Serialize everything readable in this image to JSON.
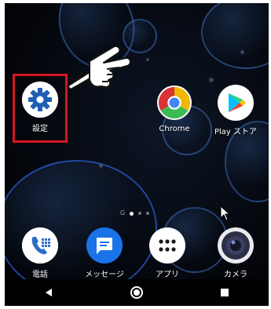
{
  "home_screen": {
    "top_row": [
      {
        "label": "設定",
        "icon": "settings-gear-icon",
        "color": "#1e5fb3"
      },
      {
        "label": "Chrome",
        "icon": "chrome-icon"
      },
      {
        "label": "Play ストア",
        "icon": "play-store-icon"
      }
    ],
    "dock": [
      {
        "label": "電話",
        "icon": "phone-icon",
        "color": "#2e6cc9"
      },
      {
        "label": "メッセージ",
        "icon": "message-icon",
        "color": "#1a73e8"
      },
      {
        "label": "アプリ",
        "icon": "app-drawer-icon",
        "color": "#ffffff"
      },
      {
        "label": "カメラ",
        "icon": "camera-icon",
        "color": "#2c2f45"
      }
    ],
    "page_indicator": {
      "glyph": "G",
      "pages": 3,
      "active_index": 0
    }
  },
  "annotation": {
    "highlight_color": "#d8141e",
    "pointer": "pointing-hand-icon"
  },
  "navigation_bar": {
    "buttons": [
      {
        "icon": "back-triangle-icon"
      },
      {
        "icon": "home-circle-icon"
      },
      {
        "icon": "recents-square-icon"
      }
    ]
  }
}
